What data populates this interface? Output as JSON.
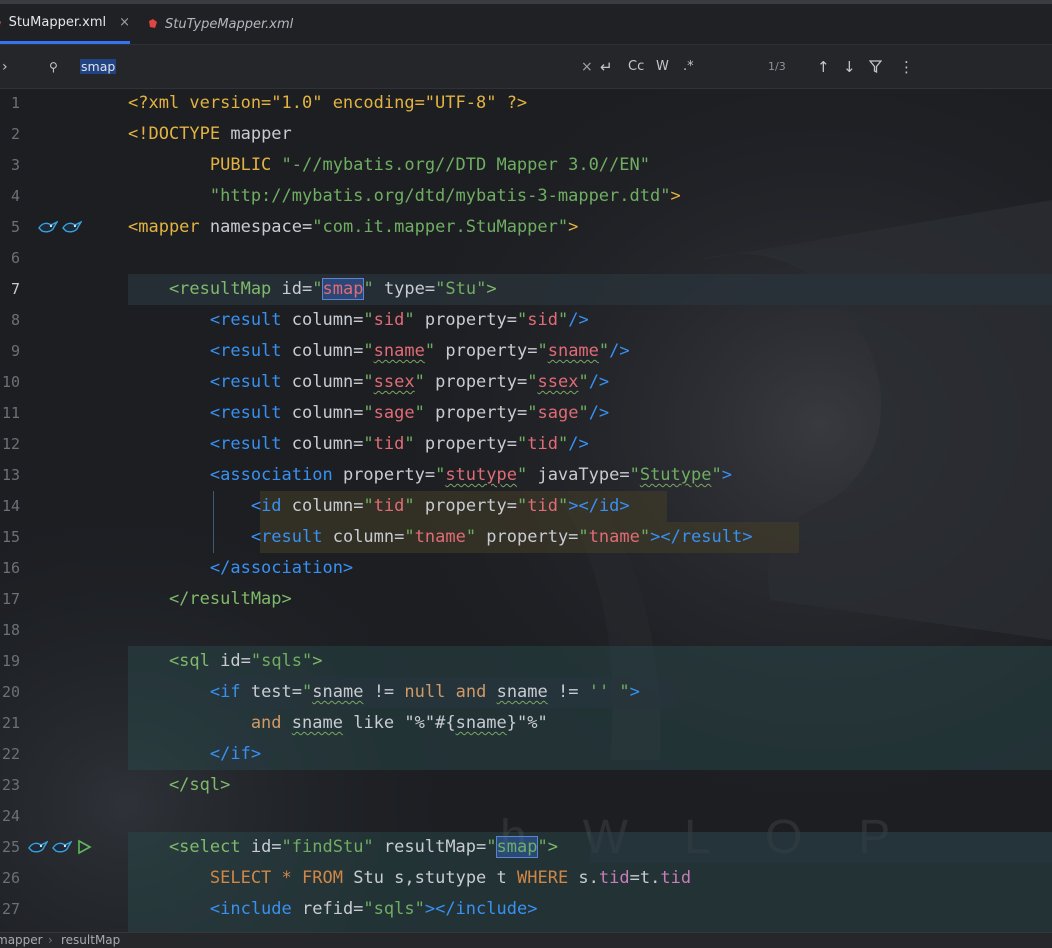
{
  "tabs": [
    {
      "label": "StuMapper.xml",
      "close": "×",
      "active": true,
      "icon": "xml-file-icon"
    },
    {
      "label": "StuTypeMapper.xml",
      "active": false,
      "icon": "xml-file-icon"
    }
  ],
  "search": {
    "expand": "›",
    "icon": "⚲",
    "query": "smap",
    "clear": "×",
    "newline": "↵",
    "match_case": "Cc",
    "words": "W",
    "regex": ".*",
    "count": "1/3",
    "prev": "↑",
    "next": "↓",
    "filter": "⛉",
    "more": "⋮"
  },
  "lines": [
    {
      "n": "1",
      "t": [
        [
          "pi",
          "<?xml version=\"1.0\" encoding=\"UTF-8\" ?>"
        ]
      ]
    },
    {
      "n": "2",
      "t": [
        [
          "pi",
          "<!DOCTYPE"
        ],
        [
          "attr",
          " mapper"
        ]
      ]
    },
    {
      "n": "3",
      "t": [
        [
          "pi",
          "        PUBLIC "
        ],
        [
          "str",
          "\"-//mybatis.org//DTD Mapper 3.0//EN\""
        ]
      ]
    },
    {
      "n": "4",
      "t": [
        [
          "str",
          "        \"http://mybatis.org/dtd/mybatis-3-mapper.dtd\""
        ],
        [
          "pi",
          ">"
        ]
      ]
    },
    {
      "n": "5",
      "t": [
        [
          "tag",
          "<mapper"
        ],
        [
          "attr",
          " namespace="
        ],
        [
          "str",
          "\"com.it.mapper.StuMapper\""
        ],
        [
          "tag",
          ">"
        ]
      ]
    },
    {
      "n": "6",
      "t": []
    },
    {
      "n": "7",
      "t": [
        [
          "gtag",
          "    <resultMap"
        ],
        [
          "attr",
          " id="
        ],
        [
          "str",
          "\""
        ],
        [
          "val match",
          "smap"
        ],
        [
          "str",
          "\""
        ],
        [
          "attr",
          " type="
        ],
        [
          "str",
          "\"Stu\""
        ],
        [
          "gtag",
          ">"
        ]
      ]
    },
    {
      "n": "8",
      "t": [
        [
          "btag",
          "        <result"
        ],
        [
          "attr",
          " column="
        ],
        [
          "str",
          "\""
        ],
        [
          "val",
          "sid"
        ],
        [
          "str",
          "\""
        ],
        [
          "attr",
          " property="
        ],
        [
          "str",
          "\""
        ],
        [
          "val",
          "sid"
        ],
        [
          "str",
          "\""
        ],
        [
          "btag",
          "/>"
        ]
      ]
    },
    {
      "n": "9",
      "t": [
        [
          "btag",
          "        <result"
        ],
        [
          "attr",
          " column="
        ],
        [
          "str",
          "\""
        ],
        [
          "val wavy",
          "sname"
        ],
        [
          "str",
          "\""
        ],
        [
          "attr",
          " property="
        ],
        [
          "str",
          "\""
        ],
        [
          "val wavy",
          "sname"
        ],
        [
          "str",
          "\""
        ],
        [
          "btag",
          "/>"
        ]
      ]
    },
    {
      "n": "10",
      "t": [
        [
          "btag",
          "        <result"
        ],
        [
          "attr",
          " column="
        ],
        [
          "str",
          "\""
        ],
        [
          "val wavy",
          "ssex"
        ],
        [
          "str",
          "\""
        ],
        [
          "attr",
          " property="
        ],
        [
          "str",
          "\""
        ],
        [
          "val wavy",
          "ssex"
        ],
        [
          "str",
          "\""
        ],
        [
          "btag",
          "/>"
        ]
      ]
    },
    {
      "n": "11",
      "t": [
        [
          "btag",
          "        <result"
        ],
        [
          "attr",
          " column="
        ],
        [
          "str",
          "\""
        ],
        [
          "val",
          "sage"
        ],
        [
          "str",
          "\""
        ],
        [
          "attr",
          " property="
        ],
        [
          "str",
          "\""
        ],
        [
          "val",
          "sage"
        ],
        [
          "str",
          "\""
        ],
        [
          "btag",
          "/>"
        ]
      ]
    },
    {
      "n": "12",
      "t": [
        [
          "btag",
          "        <result"
        ],
        [
          "attr",
          " column="
        ],
        [
          "str",
          "\""
        ],
        [
          "val",
          "tid"
        ],
        [
          "str",
          "\""
        ],
        [
          "attr",
          " property="
        ],
        [
          "str",
          "\""
        ],
        [
          "val",
          "tid"
        ],
        [
          "str",
          "\""
        ],
        [
          "btag",
          "/>"
        ]
      ]
    },
    {
      "n": "13",
      "t": [
        [
          "btag",
          "        <association"
        ],
        [
          "attr",
          " property="
        ],
        [
          "str",
          "\""
        ],
        [
          "val wavy",
          "stutype"
        ],
        [
          "str",
          "\""
        ],
        [
          "attr",
          " javaType="
        ],
        [
          "str",
          "\""
        ],
        [
          "str wavy",
          "Stutype"
        ],
        [
          "str",
          "\""
        ],
        [
          "btag",
          ">"
        ]
      ]
    },
    {
      "n": "14",
      "t": [
        [
          "attr",
          "            "
        ],
        [
          "btag",
          "<id"
        ],
        [
          "attr",
          " column="
        ],
        [
          "str",
          "\""
        ],
        [
          "val",
          "tid"
        ],
        [
          "str",
          "\""
        ],
        [
          "attr",
          " property="
        ],
        [
          "str",
          "\""
        ],
        [
          "val",
          "tid"
        ],
        [
          "str",
          "\""
        ],
        [
          "btag",
          "></id>"
        ]
      ]
    },
    {
      "n": "15",
      "t": [
        [
          "attr",
          "            "
        ],
        [
          "btag",
          "<result"
        ],
        [
          "attr",
          " column="
        ],
        [
          "str",
          "\""
        ],
        [
          "val",
          "tname"
        ],
        [
          "str",
          "\""
        ],
        [
          "attr",
          " property="
        ],
        [
          "str",
          "\""
        ],
        [
          "val",
          "tname"
        ],
        [
          "str",
          "\""
        ],
        [
          "btag",
          "></result>"
        ]
      ]
    },
    {
      "n": "16",
      "t": [
        [
          "btag",
          "        </association>"
        ]
      ]
    },
    {
      "n": "17",
      "t": [
        [
          "gtag",
          "    </resultMap>"
        ]
      ]
    },
    {
      "n": "18",
      "t": []
    },
    {
      "n": "19",
      "t": [
        [
          "gtag",
          "    <sql"
        ],
        [
          "attr",
          " id="
        ],
        [
          "str",
          "\"sqls\""
        ],
        [
          "gtag",
          ">"
        ]
      ]
    },
    {
      "n": "20",
      "t": [
        [
          "brk",
          "        <if"
        ],
        [
          "attr",
          " test="
        ],
        [
          "str",
          "\""
        ],
        [
          "attr wavy",
          "sname"
        ],
        [
          "attr",
          " != "
        ],
        [
          "ocr",
          "null"
        ],
        [
          "attr",
          " "
        ],
        [
          "ocr",
          "and"
        ],
        [
          "attr",
          " "
        ],
        [
          "attr wavy",
          "sname"
        ],
        [
          "attr",
          " != "
        ],
        [
          "str",
          "'' \""
        ],
        [
          "brk",
          ">"
        ]
      ]
    },
    {
      "n": "21",
      "t": [
        [
          "ocr",
          "            and"
        ],
        [
          "attr",
          " "
        ],
        [
          "attr wavy",
          "sname"
        ],
        [
          "attr",
          " like "
        ],
        [
          "attr",
          "\"%\"#{"
        ],
        [
          "attr wavy",
          "sname"
        ],
        [
          "attr",
          "}\"%\""
        ]
      ]
    },
    {
      "n": "22",
      "t": [
        [
          "brk",
          "        </if>"
        ]
      ]
    },
    {
      "n": "23",
      "t": [
        [
          "gtag",
          "    </sql>"
        ]
      ]
    },
    {
      "n": "24",
      "t": []
    },
    {
      "n": "25",
      "t": [
        [
          "gtag",
          "    <select"
        ],
        [
          "attr",
          " id="
        ],
        [
          "str",
          "\"findStu\""
        ],
        [
          "attr",
          " resultMap="
        ],
        [
          "str",
          "\""
        ],
        [
          "str match",
          "smap"
        ],
        [
          "str",
          "\""
        ],
        [
          "gtag",
          ">"
        ]
      ]
    },
    {
      "n": "26",
      "t": [
        [
          "sqlkw",
          "        SELECT"
        ],
        [
          "attr",
          " "
        ],
        [
          "sqlkw",
          "*"
        ],
        [
          "attr",
          " "
        ],
        [
          "sqlkw",
          "FROM"
        ],
        [
          "attr",
          " Stu s,stutype t "
        ],
        [
          "sqlkw",
          "WHERE"
        ],
        [
          "attr",
          " s."
        ],
        [
          "sqlfld",
          "tid"
        ],
        [
          "attr",
          "=t."
        ],
        [
          "sqlfld",
          "tid"
        ]
      ]
    },
    {
      "n": "27",
      "t": [
        [
          "brk",
          "        <include"
        ],
        [
          "attr",
          " refid="
        ],
        [
          "str",
          "\"sqls\""
        ],
        [
          "brk",
          "></include>"
        ]
      ]
    }
  ],
  "gutter_icons": {
    "5": [
      "mybatis-bird-icon",
      "mybatis-bird-icon"
    ],
    "25": [
      "mybatis-bird-icon",
      "mybatis-bird-icon",
      "run-play-icon"
    ]
  },
  "watermark": "h   W   L   O   P",
  "breadcrumb": [
    "mapper",
    "resultMap"
  ],
  "colors": {
    "accent": "#3574f0",
    "background": "#1c1e22",
    "match": "#214283"
  }
}
